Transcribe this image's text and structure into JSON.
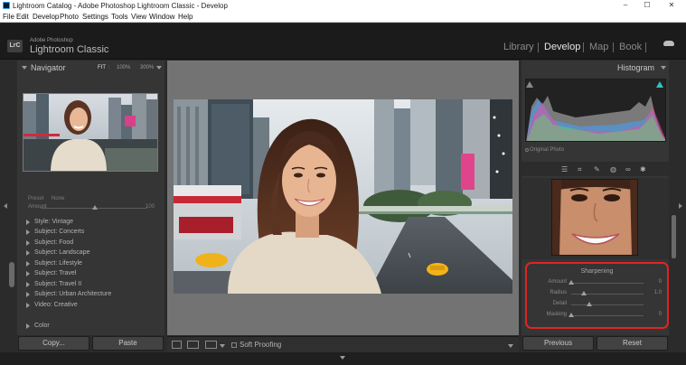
{
  "window": {
    "title": "Lightroom Catalog - Adobe Photoshop Lightroom Classic - Develop",
    "controls": {
      "minimize": "–",
      "maximize": "☐",
      "close": "✕"
    }
  },
  "menu": [
    "File",
    "Edit",
    "Develop",
    "Photo",
    "Settings",
    "Tools",
    "View",
    "Window",
    "Help"
  ],
  "identity": {
    "badge": "LrC",
    "vendor": "Adobe Photoshop",
    "product": "Lightroom Classic"
  },
  "modules": [
    {
      "label": "Library",
      "active": false
    },
    {
      "label": "Develop",
      "active": true
    },
    {
      "label": "Map",
      "active": false
    },
    {
      "label": "Book",
      "active": false
    }
  ],
  "navigator": {
    "title": "Navigator",
    "zoom_options": [
      "FIT",
      "100%",
      "300%"
    ],
    "active_zoom": "FIT",
    "zoom_sep": ":"
  },
  "preset_strip": {
    "label_1": "Preset",
    "label_2": "None",
    "amount_label": "Amount",
    "amount_value": "100"
  },
  "presets": [
    "Style: Vintage",
    "Subject: Concerts",
    "Subject: Food",
    "Subject: Landscape",
    "Subject: Lifestyle",
    "Subject: Travel",
    "Subject: Travel II",
    "Subject: Urban Architecture",
    "Video: Creative",
    "Color"
  ],
  "left_buttons": {
    "copy": "Copy...",
    "paste": "Paste"
  },
  "toolbar": {
    "soft_proofing": "Soft Proofing"
  },
  "histogram": {
    "title": "Histogram",
    "original_photo": "Original Photo"
  },
  "detail": {
    "section_title": "Sharpening",
    "sliders": [
      {
        "label": "Amount",
        "value": "0",
        "level": 0.0
      },
      {
        "label": "Radius",
        "value": "1.0",
        "level": 0.17
      },
      {
        "label": "Detail",
        "value": "",
        "level": 0.25
      },
      {
        "label": "Masking",
        "value": "0",
        "level": 0.0
      }
    ]
  },
  "right_buttons": {
    "previous": "Previous",
    "reset": "Reset"
  },
  "colors": {
    "highlight_outline": "#e02424",
    "panel": "#353535",
    "background": "#2b2b2b"
  }
}
